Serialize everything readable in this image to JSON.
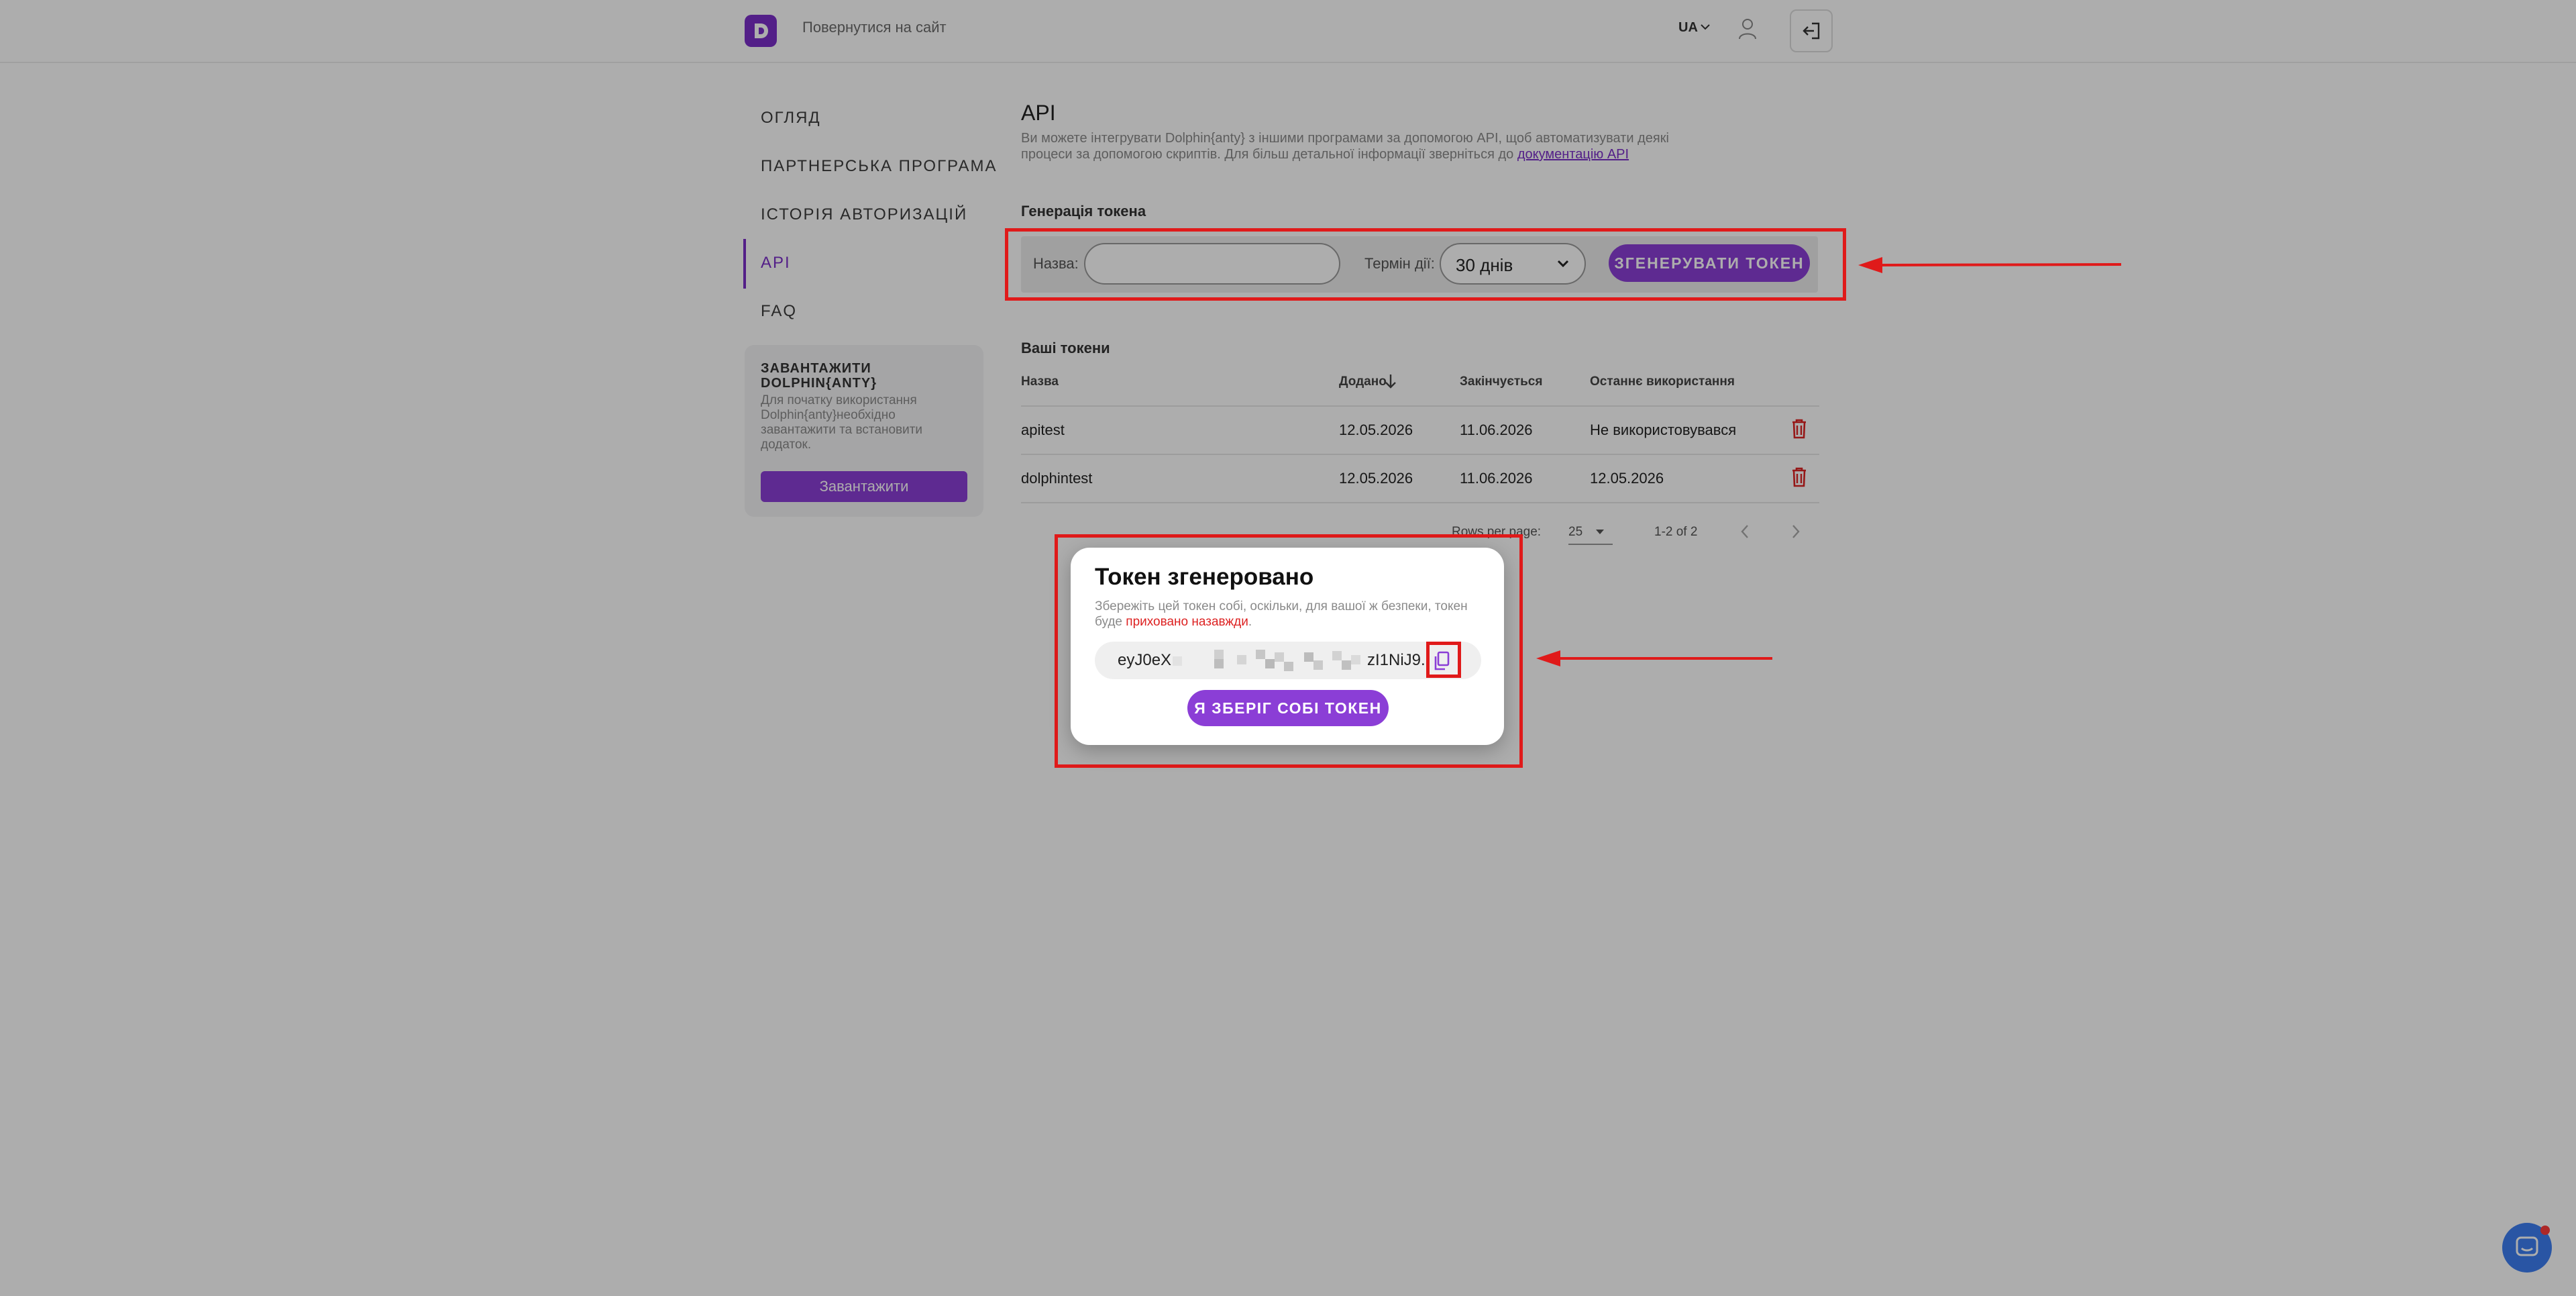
{
  "topbar": {
    "back_link": "Повернутися на сайт",
    "language": "UA"
  },
  "sidebar": {
    "items": [
      {
        "label": "ОГЛЯД"
      },
      {
        "label": "ПАРТНЕРСЬКА ПРОГРАМА"
      },
      {
        "label": "ІСТОРІЯ АВТОРИЗАЦІЙ"
      },
      {
        "label": "API",
        "active": true
      },
      {
        "label": "FAQ"
      }
    ],
    "download": {
      "title": "ЗАВАНТАЖИТИ DOLPHIN{ANTY}",
      "description": "Для початку використання Dolphin{anty}необхідно завантажити та встановити додаток.",
      "button": "Завантажити"
    }
  },
  "main": {
    "title": "API",
    "intro_text": "Ви можете інтегрувати Dolphin{anty} з іншими програмами за допомогою API, щоб автоматизувати деякі процеси за допомогою скриптів. Для більш детальної інформації зверніться до",
    "intro_link": "документацію API",
    "generate": {
      "section_title": "Генерація токена",
      "name_label": "Назва:",
      "name_value": "",
      "term_label": "Термін дії:",
      "term_value": "30 днів",
      "button": "ЗГЕНЕРУВАТИ ТОКЕН"
    },
    "tokens": {
      "section_title": "Ваші токени",
      "columns": [
        "Назва",
        "Додано",
        "Закінчується",
        "Останнє використання"
      ],
      "rows": [
        {
          "name": "apitest",
          "added": "12.05.2026",
          "expires": "11.06.2026",
          "last_used": "Не використовувався"
        },
        {
          "name": "dolphintest",
          "added": "12.05.2026",
          "expires": "11.06.2026",
          "last_used": "12.05.2026"
        }
      ],
      "rows_per_page_label": "Rows per page:",
      "rows_per_page_value": "25",
      "range": "1-2 of 2"
    }
  },
  "modal": {
    "title": "Токен згенеровано",
    "desc_before": "Збережіть цей токен собі, оскільки, для вашої ж безпеки, токен буде",
    "desc_warn": "приховано назавжди",
    "desc_after": ".",
    "token_start": "eyJ0eX",
    "token_end": "zI1NiJ9.",
    "button": "Я ЗБЕРІГ СОБІ ТОКЕН"
  },
  "colors": {
    "accent": "#8b3ed6",
    "annotation": "#e01a1a",
    "danger": "#d22222"
  }
}
